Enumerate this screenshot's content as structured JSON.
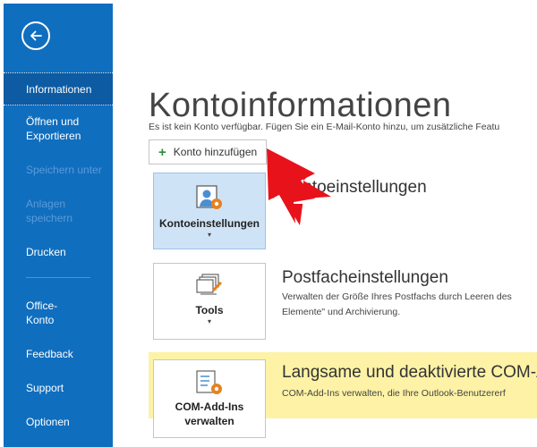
{
  "sidebar": {
    "items": [
      {
        "label": "Informationen"
      },
      {
        "label": "Öffnen und Exportieren"
      },
      {
        "label": "Speichern unter"
      },
      {
        "label": "Anlagen speichern"
      },
      {
        "label": "Drucken"
      },
      {
        "label": "Office-Konto"
      },
      {
        "label": "Feedback"
      },
      {
        "label": "Support"
      },
      {
        "label": "Optionen"
      }
    ]
  },
  "main": {
    "title": "Kontoinformationen",
    "no_account_text": "Es ist kein Konto verfügbar. Fügen Sie ein E-Mail-Konto hinzu, um zusätzliche Featu",
    "add_account_label": "Konto hinzufügen",
    "sections": [
      {
        "tile_label": "Kontoeinstellungen",
        "title": "Kontoeinstellungen",
        "title_visible": "toeinstellungen"
      },
      {
        "tile_label": "Tools",
        "title": "Postfacheinstellungen",
        "desc_line1": "Verwalten der Größe Ihres Postfachs durch Leeren des",
        "desc_line2": "Elemente\" und Archivierung."
      },
      {
        "tile_label_line1": "COM-Add-Ins",
        "tile_label_line2": "verwalten",
        "title": "Langsame und deaktivierte COM-A",
        "desc_line1": "COM-Add-Ins verwalten, die Ihre Outlook-Benutzererf"
      }
    ]
  },
  "colors": {
    "sidebar": "#106ebe",
    "selected_tile": "#cfe3f6",
    "highlight": "#fdf2a5",
    "arrow": "#e8121b"
  },
  "icons": [
    "back-arrow-icon",
    "plus-icon",
    "account-settings-icon",
    "tools-icon",
    "com-addins-icon",
    "dropdown-caret-icon",
    "red-pointer-arrow"
  ]
}
